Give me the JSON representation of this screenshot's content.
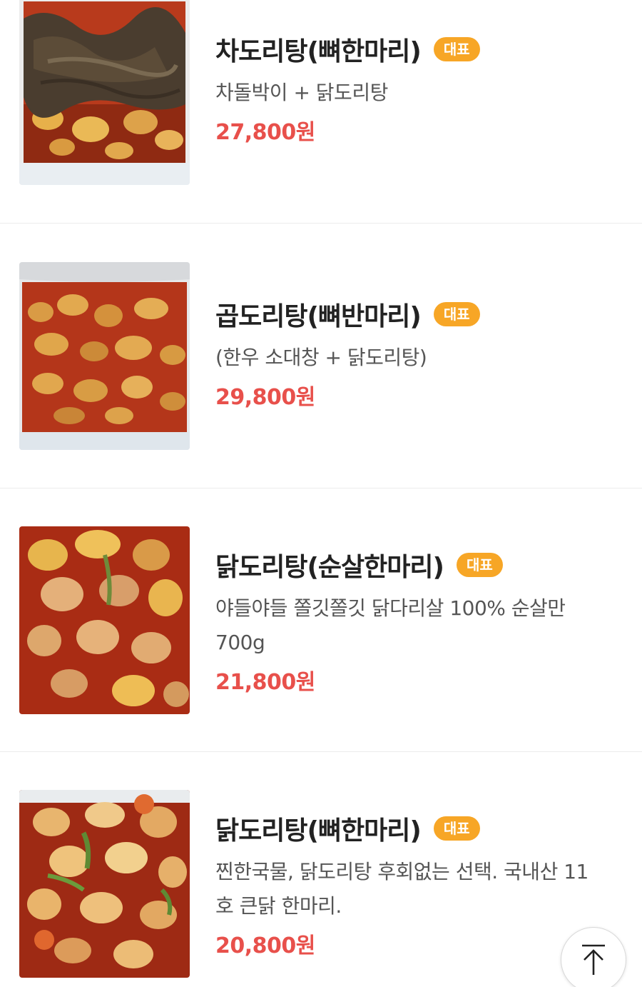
{
  "menu": {
    "items": [
      {
        "name": "차도리탕(뼈한마리)",
        "badge": "대표",
        "description": "차돌박이 + 닭도리탕",
        "price": "27,800원",
        "image": "spicy-chicken-stew-with-beef-brisket"
      },
      {
        "name": "곱도리탕(뼈반마리)",
        "badge": "대표",
        "description": "(한우 소대창 + 닭도리탕)",
        "price": "29,800원",
        "image": "spicy-chicken-stew-with-beef-intestine"
      },
      {
        "name": "닭도리탕(순살한마리)",
        "badge": "대표",
        "description": "야들야들 쫄깃쫄깃 닭다리살 100% 순살만 700g",
        "price": "21,800원",
        "image": "boneless-spicy-chicken-stew"
      },
      {
        "name": "닭도리탕(뼈한마리)",
        "badge": "대표",
        "description": "찐한국물, 닭도리탕 후회없는 선택. 국내산 11호 큰닭 한마리.",
        "price": "20,800원",
        "image": "bone-in-spicy-chicken-stew"
      }
    ]
  },
  "colors": {
    "badge_bg": "#f7a626",
    "price": "#e8504b",
    "divider": "#ececec"
  },
  "scroll_top_icon": "arrow-up-to-top-icon"
}
